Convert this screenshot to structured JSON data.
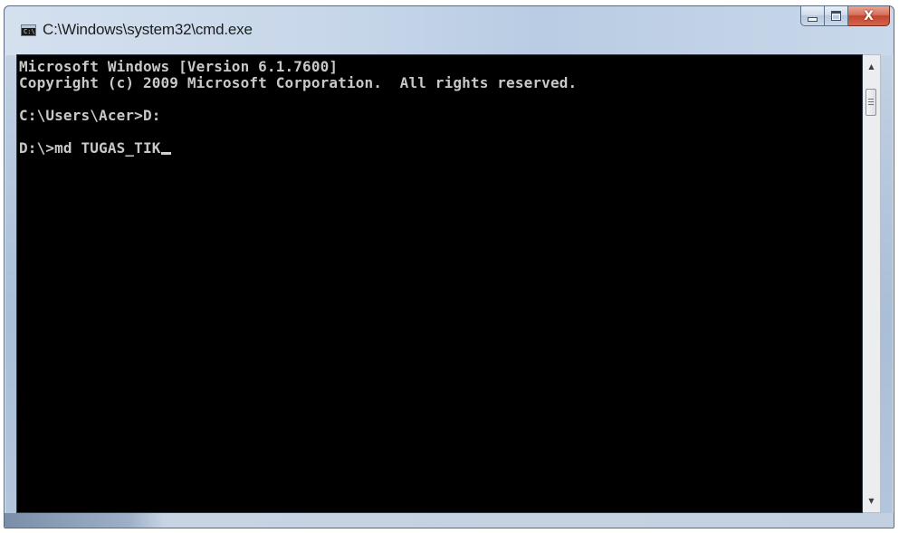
{
  "window": {
    "title": "C:\\Windows\\system32\\cmd.exe",
    "icon_text": "C:\\",
    "icon": "cmd-icon"
  },
  "caption_buttons": {
    "minimize_icon": "minimize-icon",
    "maximize_icon": "maximize-icon",
    "close_icon": "close-icon",
    "close_glyph": "X"
  },
  "console": {
    "lines": [
      "Microsoft Windows [Version 6.1.7600]",
      "Copyright (c) 2009 Microsoft Corporation.  All rights reserved.",
      "",
      "C:\\Users\\Acer>D:",
      "",
      "D:\\>md TUGAS_TIK"
    ],
    "text_color": "#c0c0c0",
    "background_color": "#000000"
  },
  "scrollbar": {
    "up_arrow": "▲",
    "down_arrow": "▼"
  }
}
